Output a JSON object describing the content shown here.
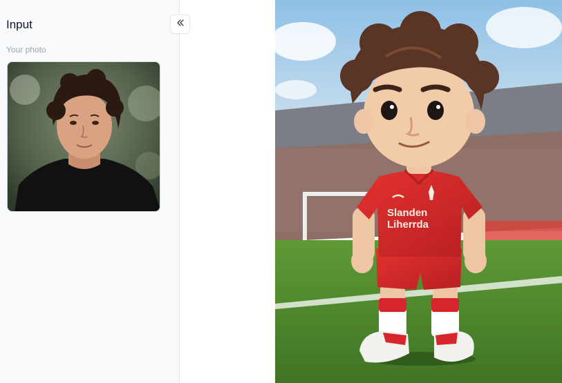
{
  "sidebar": {
    "title": "Input",
    "section_label": "Your photo",
    "collapse_icon": "chevrons-left-icon"
  },
  "input_photo": {
    "alt": "Your photo"
  },
  "output_image": {
    "alt": "Generated figurine",
    "jersey_text_line1": "Slanden",
    "jersey_text_line2": "Liherrda"
  },
  "colors": {
    "sidebar_bg": "#f8fafc",
    "jersey_red": "#d7262b",
    "pitch_green": "#4f8a2e",
    "sky_blue": "#9cc6e4"
  }
}
